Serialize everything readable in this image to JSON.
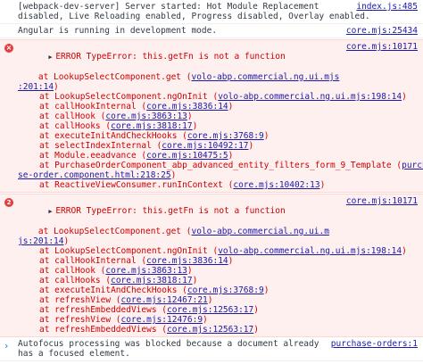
{
  "messages": [
    {
      "type": "info",
      "lines": [
        "[webpack-dev-server] Server started: Hot Module Replacement",
        "disabled, Live Reloading enabled, Progress disabled, Overlay enabled."
      ],
      "source": "index.js:485"
    },
    {
      "type": "info",
      "lines": [
        "Angular is running in development mode."
      ],
      "source": "core.mjs:25434"
    }
  ],
  "error1": {
    "icon": "×",
    "source": "core.mjs:10171",
    "title": "ERROR TypeError: this.getFn is not a function",
    "first_frame": {
      "fn": "    at LookupSelectComponent.get",
      "link1": "volo-abp.commercial.ng.ui.mjs",
      "link2": ":201:14"
    },
    "frames": [
      {
        "fn": "at LookupSelectComponent.ngOnInit",
        "link": "volo-abp.commercial.ng.ui.mjs:198:14"
      },
      {
        "fn": "at callHookInternal",
        "link": "core.mjs:3836:14"
      },
      {
        "fn": "at callHook",
        "link": "core.mjs:3863:13"
      },
      {
        "fn": "at callHooks",
        "link": "core.mjs:3818:17"
      },
      {
        "fn": "at executeInitAndCheckHooks",
        "link": "core.mjs:3768:9"
      },
      {
        "fn": "at selectIndexInternal",
        "link": "core.mjs:10492:17"
      },
      {
        "fn": "at Module.eeadvance",
        "link": "core.mjs:10475:5"
      }
    ],
    "long_frame": {
      "fn": "at PurchaseOrderComponent_abp_advanced_entity_filters_form_9_Template",
      "link1": "purcha",
      "link2": "se-order.component.html:218:25"
    },
    "last_frame": {
      "fn": "at ReactiveViewConsumer.runInContext",
      "link": "core.mjs:10402:13"
    }
  },
  "error2": {
    "count": "2",
    "source": "core.mjs:10171",
    "title": "ERROR TypeError: this.getFn is not a function",
    "first_frame": {
      "fn": "    at LookupSelectComponent.get",
      "link1": "volo-abp.commercial.ng.ui.m",
      "link2": "js:201:14"
    },
    "frames": [
      {
        "fn": "at LookupSelectComponent.ngOnInit",
        "link": "volo-abp.commercial.ng.ui.mjs:198:14"
      },
      {
        "fn": "at callHookInternal",
        "link": "core.mjs:3836:14"
      },
      {
        "fn": "at callHook",
        "link": "core.mjs:3863:13"
      },
      {
        "fn": "at callHooks",
        "link": "core.mjs:3818:17"
      },
      {
        "fn": "at executeInitAndCheckHooks",
        "link": "core.mjs:3768:9"
      },
      {
        "fn": "at refreshView",
        "link": "core.mjs:12467:21"
      },
      {
        "fn": "at refreshEmbeddedViews",
        "link": "core.mjs:12563:17"
      },
      {
        "fn": "at refreshView",
        "link": "core.mjs:12476:9"
      },
      {
        "fn": "at refreshEmbeddedViews",
        "link": "core.mjs:12563:17"
      }
    ]
  },
  "autofocus": {
    "lines": [
      "Autofocus processing was blocked because a document already",
      "has a focused element."
    ],
    "source": "purchase-orders:1"
  },
  "prompt_symbol": "›"
}
